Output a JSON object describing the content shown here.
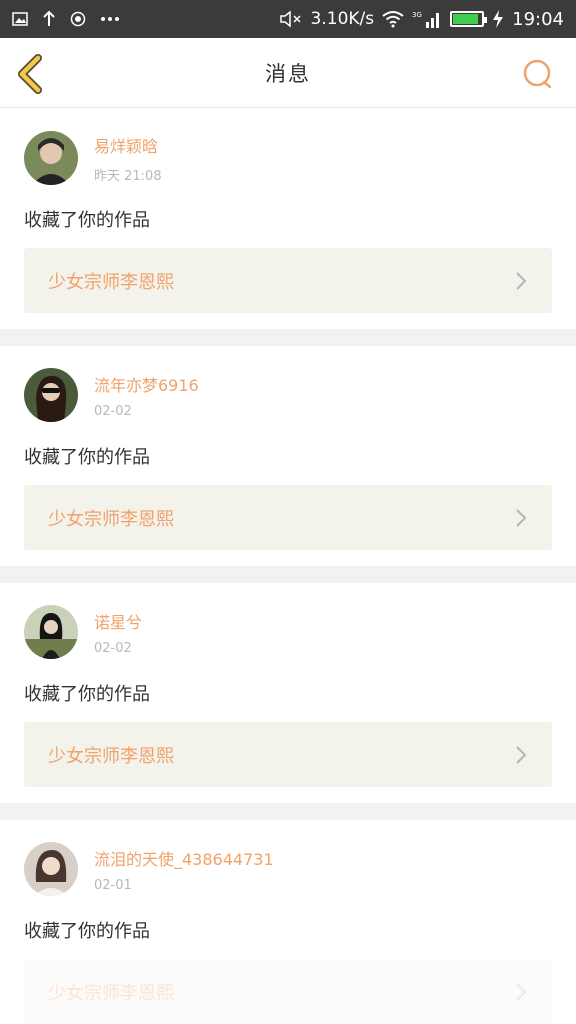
{
  "status_bar": {
    "speed": "3.10K/s",
    "network_label": "3G",
    "time": "19:04",
    "battery_level": 0.9
  },
  "nav": {
    "title": "消息",
    "back_icon": "chevron-left-icon",
    "search_icon": "search-icon"
  },
  "messages": [
    {
      "username": "易烊颖晗",
      "timestamp": "昨天 21:08",
      "action": "收藏了你的作品",
      "work_title": "少女宗师李恩熙"
    },
    {
      "username": "流年亦梦6916",
      "timestamp": "02-02",
      "action": "收藏了你的作品",
      "work_title": "少女宗师李恩熙"
    },
    {
      "username": "诺星兮",
      "timestamp": "02-02",
      "action": "收藏了你的作品",
      "work_title": "少女宗师李恩熙"
    },
    {
      "username": "流泪的天使_438644731",
      "timestamp": "02-01",
      "action": "收藏了你的作品",
      "work_title": "少女宗师李恩熙"
    }
  ],
  "colors": {
    "accent": "#f0a26a",
    "back_icon": "#f2c94c",
    "work_box_bg": "#f3f3ec",
    "status_bar_bg": "#3b3b3b"
  }
}
